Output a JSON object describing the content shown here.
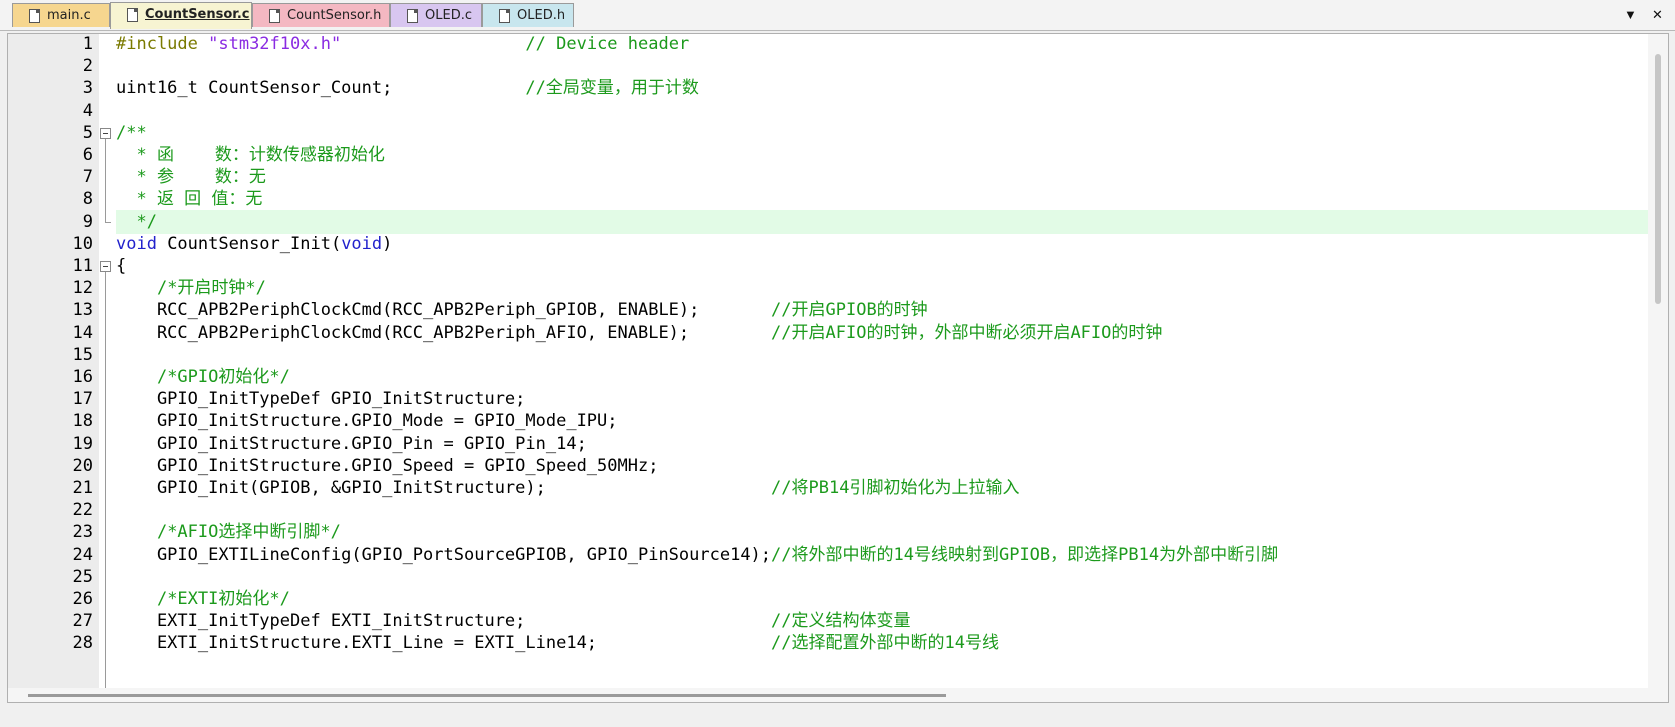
{
  "tabs": [
    {
      "label": "main.c",
      "active": false,
      "color": "#f6d68f"
    },
    {
      "label": "CountSensor.c",
      "active": true,
      "color": "#f7f4d2"
    },
    {
      "label": "CountSensor.h",
      "active": false,
      "color": "#f4b8c2"
    },
    {
      "label": "OLED.c",
      "active": false,
      "color": "#d8c6f0"
    },
    {
      "label": "OLED.h",
      "active": false,
      "color": "#c8e6ee"
    }
  ],
  "tab_icons": {
    "tab": "document-icon",
    "dropdown": "chevron-down-icon",
    "close": "close-icon"
  },
  "toolbar": {
    "dropdown_label": "▼",
    "close_label": "✕"
  },
  "editor": {
    "highlight_color": "#e2fbe6",
    "lines": [
      {
        "no": "1",
        "seg": [
          {
            "c": "pp",
            "t": "#include "
          },
          {
            "c": "str",
            "t": "\"stm32f10x.h\""
          },
          {
            "c": "tx",
            "t": "                  "
          },
          {
            "c": "cm",
            "t": "// Device header"
          }
        ]
      },
      {
        "no": "2",
        "seg": []
      },
      {
        "no": "3",
        "seg": [
          {
            "c": "tx",
            "t": "uint16_t CountSensor_Count;             "
          },
          {
            "c": "cm",
            "t": "//全局变量，用于计数"
          }
        ]
      },
      {
        "no": "4",
        "seg": []
      },
      {
        "no": "5",
        "seg": [
          {
            "c": "cm",
            "t": "/**"
          }
        ],
        "fold": "start"
      },
      {
        "no": "6",
        "seg": [
          {
            "c": "cm",
            "t": "  * 函    数：计数传感器初始化"
          }
        ]
      },
      {
        "no": "7",
        "seg": [
          {
            "c": "cm",
            "t": "  * 参    数：无"
          }
        ]
      },
      {
        "no": "8",
        "seg": [
          {
            "c": "cm",
            "t": "  * 返 回 值：无"
          }
        ]
      },
      {
        "no": "9",
        "seg": [
          {
            "c": "cm",
            "t": "  */"
          }
        ],
        "fold": "end",
        "highlight": true
      },
      {
        "no": "10",
        "seg": [
          {
            "c": "kw",
            "t": "void"
          },
          {
            "c": "tx",
            "t": " CountSensor_Init("
          },
          {
            "c": "kw",
            "t": "void"
          },
          {
            "c": "tx",
            "t": ")"
          }
        ]
      },
      {
        "no": "11",
        "seg": [
          {
            "c": "tx",
            "t": "{"
          }
        ],
        "fold": "start"
      },
      {
        "no": "12",
        "seg": [
          {
            "c": "tx",
            "t": "    "
          },
          {
            "c": "cm",
            "t": "/*开启时钟*/"
          }
        ]
      },
      {
        "no": "13",
        "seg": [
          {
            "c": "tx",
            "t": "    RCC_APB2PeriphClockCmd(RCC_APB2Periph_GPIOB, ENABLE);       "
          },
          {
            "c": "cm",
            "t": "//开启GPIOB的时钟"
          }
        ]
      },
      {
        "no": "14",
        "seg": [
          {
            "c": "tx",
            "t": "    RCC_APB2PeriphClockCmd(RCC_APB2Periph_AFIO, ENABLE);        "
          },
          {
            "c": "cm",
            "t": "//开启AFIO的时钟，外部中断必须开启AFIO的时钟"
          }
        ]
      },
      {
        "no": "15",
        "seg": []
      },
      {
        "no": "16",
        "seg": [
          {
            "c": "tx",
            "t": "    "
          },
          {
            "c": "cm",
            "t": "/*GPIO初始化*/"
          }
        ]
      },
      {
        "no": "17",
        "seg": [
          {
            "c": "tx",
            "t": "    GPIO_InitTypeDef GPIO_InitStructure;"
          }
        ]
      },
      {
        "no": "18",
        "seg": [
          {
            "c": "tx",
            "t": "    GPIO_InitStructure.GPIO_Mode = GPIO_Mode_IPU;"
          }
        ]
      },
      {
        "no": "19",
        "seg": [
          {
            "c": "tx",
            "t": "    GPIO_InitStructure.GPIO_Pin = GPIO_Pin_14;"
          }
        ]
      },
      {
        "no": "20",
        "seg": [
          {
            "c": "tx",
            "t": "    GPIO_InitStructure.GPIO_Speed = GPIO_Speed_50MHz;"
          }
        ]
      },
      {
        "no": "21",
        "seg": [
          {
            "c": "tx",
            "t": "    GPIO_Init(GPIOB, &GPIO_InitStructure);                      "
          },
          {
            "c": "cm",
            "t": "//将PB14引脚初始化为上拉输入"
          }
        ]
      },
      {
        "no": "22",
        "seg": []
      },
      {
        "no": "23",
        "seg": [
          {
            "c": "tx",
            "t": "    "
          },
          {
            "c": "cm",
            "t": "/*AFIO选择中断引脚*/"
          }
        ]
      },
      {
        "no": "24",
        "seg": [
          {
            "c": "tx",
            "t": "    GPIO_EXTILineConfig(GPIO_PortSourceGPIOB, GPIO_PinSource14);"
          },
          {
            "c": "cm",
            "t": "//将外部中断的14号线映射到GPIOB，即选择PB14为外部中断引脚"
          }
        ]
      },
      {
        "no": "25",
        "seg": []
      },
      {
        "no": "26",
        "seg": [
          {
            "c": "tx",
            "t": "    "
          },
          {
            "c": "cm",
            "t": "/*EXTI初始化*/"
          }
        ]
      },
      {
        "no": "27",
        "seg": [
          {
            "c": "tx",
            "t": "    EXTI_InitTypeDef EXTI_InitStructure;                        "
          },
          {
            "c": "cm",
            "t": "//定义结构体变量"
          }
        ]
      },
      {
        "no": "28",
        "seg": [
          {
            "c": "tx",
            "t": "    EXTI_InitStructure.EXTI_Line = EXTI_Line14;                 "
          },
          {
            "c": "cm",
            "t": "//选择配置外部中断的14号线"
          }
        ]
      }
    ]
  }
}
